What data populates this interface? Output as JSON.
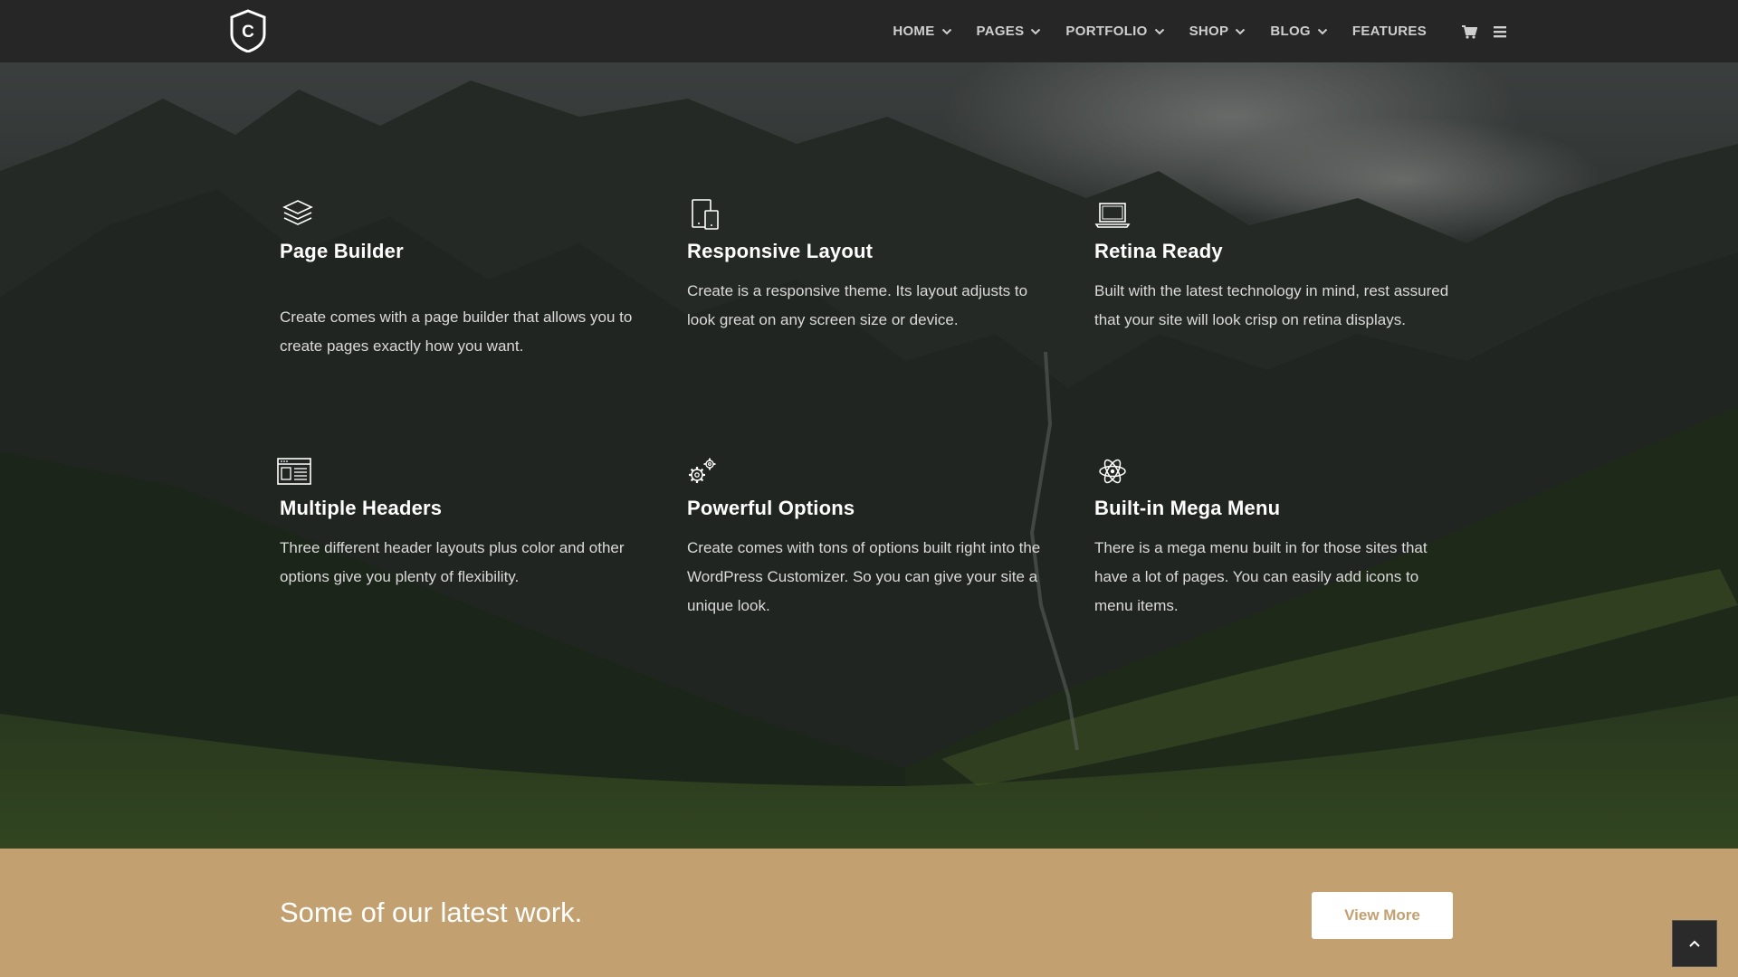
{
  "header": {
    "logo_letter": "C",
    "nav": [
      {
        "label": "HOME",
        "has_dropdown": true
      },
      {
        "label": "PAGES",
        "has_dropdown": true
      },
      {
        "label": "PORTFOLIO",
        "has_dropdown": true
      },
      {
        "label": "SHOP",
        "has_dropdown": true
      },
      {
        "label": "BLOG",
        "has_dropdown": true
      },
      {
        "label": "FEATURES",
        "has_dropdown": false
      }
    ],
    "icons": [
      "cart-icon",
      "hamburger-menu-icon"
    ]
  },
  "features": [
    {
      "icon": "layers-icon",
      "title": "Page Builder",
      "text": "Create comes with a page builder that allows you to create pages exactly how you want."
    },
    {
      "icon": "devices-icon",
      "title": "Responsive Layout",
      "text": "Create is a responsive theme. Its layout adjusts to look great on any screen size or device."
    },
    {
      "icon": "laptop-icon",
      "title": "Retina Ready",
      "text": "Built with the latest technology in mind, rest assured that your site will look crisp on retina displays."
    },
    {
      "icon": "browser-layout-icon",
      "title": "Multiple Headers",
      "text": "Three different header layouts plus color and other options give you plenty of flexibility."
    },
    {
      "icon": "gears-icon",
      "title": "Powerful Options",
      "text": "Create comes with tons of options built right into the WordPress Customizer. So you can give your site a unique look."
    },
    {
      "icon": "atom-icon",
      "title": "Built-in Mega Menu",
      "text": "There is a mega menu built in for those sites that have a lot of pages. You can easily add icons to menu items."
    }
  ],
  "band": {
    "text": "Some of our latest work.",
    "button_label": "View More"
  },
  "colors": {
    "header_bg": "#262626",
    "band_bg": "#c3a070",
    "button_text": "#c3a070"
  }
}
